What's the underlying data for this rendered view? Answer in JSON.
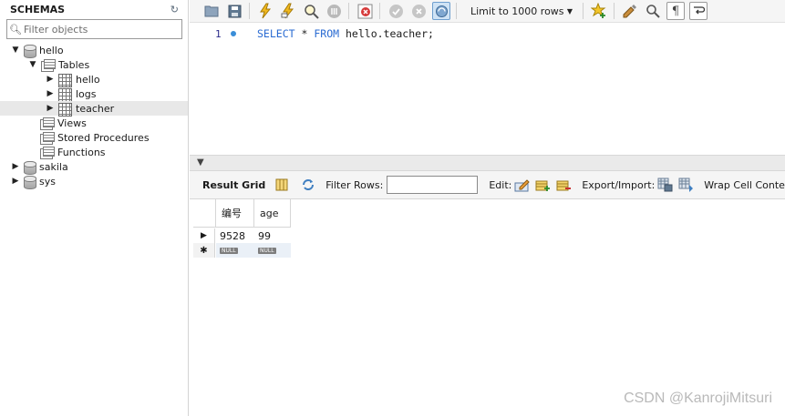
{
  "sidebar": {
    "title": "SCHEMAS",
    "filter_placeholder": "Filter objects",
    "schemas": [
      {
        "name": "hello",
        "expanded": true,
        "tables_label": "Tables",
        "tables": [
          "hello",
          "logs",
          "teacher"
        ],
        "selected_table": "teacher",
        "views_label": "Views",
        "procedures_label": "Stored Procedures",
        "functions_label": "Functions"
      },
      {
        "name": "sakila",
        "expanded": false
      },
      {
        "name": "sys",
        "expanded": false
      }
    ]
  },
  "toolbar": {
    "limit_label": "Limit to 1000 rows",
    "icons": [
      "open-file-icon",
      "save-icon",
      "execute-icon",
      "execute-current-icon",
      "explain-icon",
      "stop-icon",
      "toggle-error-icon",
      "commit-icon",
      "rollback-icon",
      "autocommit-icon",
      "limit-select",
      "bookmark-icon",
      "beautify-icon",
      "find-icon",
      "invisible-chars-icon",
      "wrap-icon"
    ]
  },
  "editor": {
    "line_number": "1",
    "sql_keyword_1": "SELECT",
    "sql_star": "*",
    "sql_keyword_2": "FROM",
    "sql_target": "hello.teacher;"
  },
  "result_toolbar": {
    "result_grid_label": "Result Grid",
    "filter_rows_label": "Filter Rows:",
    "edit_label": "Edit:",
    "export_label": "Export/Import:",
    "wrap_label": "Wrap Cell Content:"
  },
  "grid": {
    "columns": [
      "编号",
      "age"
    ],
    "rows": [
      [
        "9528",
        "99"
      ]
    ],
    "new_row": [
      "NULL",
      "NULL"
    ]
  },
  "watermark": "CSDN @KanrojiMitsuri"
}
